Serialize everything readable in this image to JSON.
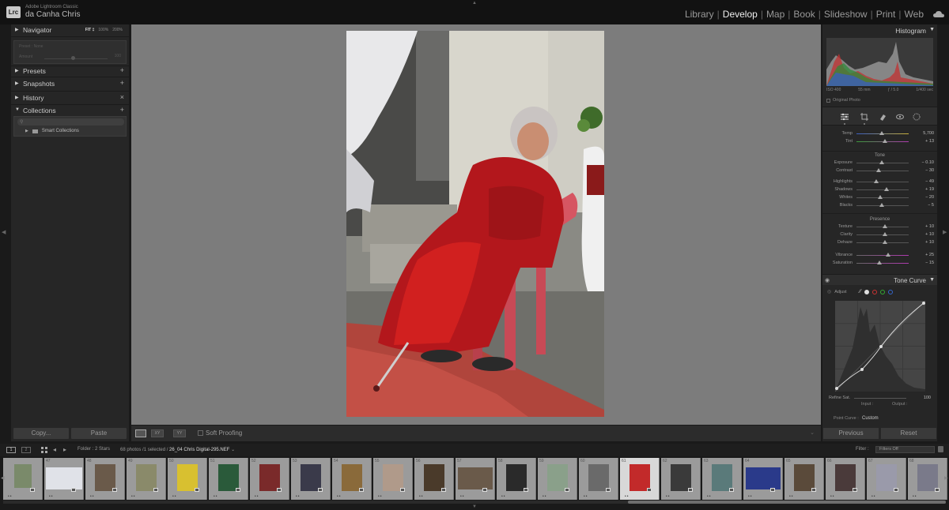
{
  "app": {
    "logo_text": "Lrc",
    "product_name": "Adobe Lightroom Classic",
    "user_name": "da Canha Chris"
  },
  "modules": [
    {
      "label": "Library",
      "active": false
    },
    {
      "label": "Develop",
      "active": true
    },
    {
      "label": "Map",
      "active": false
    },
    {
      "label": "Book",
      "active": false
    },
    {
      "label": "Slideshow",
      "active": false
    },
    {
      "label": "Print",
      "active": false
    },
    {
      "label": "Web",
      "active": false
    }
  ],
  "left_panel": {
    "navigator": {
      "label": "Navigator",
      "zoom_fit": "FIT ‡",
      "zoom_100": "100%",
      "zoom_200": "200%"
    },
    "navigator_preset": "Preset : None",
    "navigator_amount": "Amount",
    "navigator_amount_value": "100",
    "presets": {
      "label": "Presets"
    },
    "snapshots": {
      "label": "Snapshots"
    },
    "history": {
      "label": "History"
    },
    "collections": {
      "label": "Collections"
    },
    "smart_collections": "Smart Collections",
    "copy_label": "Copy...",
    "paste_label": "Paste"
  },
  "toolbar": {
    "soft_proofing_label": "Soft Proofing",
    "compare_label": "XY",
    "survey_label": "YY"
  },
  "right_panel": {
    "histogram_title": "Histogram",
    "iso": "ISO 400",
    "focal": "55 mm",
    "aperture": "ƒ / 5.0",
    "shutter": "1/400 sec",
    "original_photo": "Original Photo",
    "sections": {
      "tone": "Tone",
      "presence": "Presence"
    },
    "wb_sliders": [
      {
        "label": "Temp",
        "value": "5,700",
        "pos": 0.48
      },
      {
        "label": "Tint",
        "value": "+ 13",
        "pos": 0.55
      }
    ],
    "tone_sliders": [
      {
        "label": "Exposure",
        "value": "− 0.10",
        "pos": 0.48
      },
      {
        "label": "Contrast",
        "value": "− 30",
        "pos": 0.42
      },
      {
        "label": "Highlights",
        "value": "− 49",
        "pos": 0.38
      },
      {
        "label": "Shadows",
        "value": "+ 19",
        "pos": 0.58
      },
      {
        "label": "Whites",
        "value": "− 20",
        "pos": 0.45
      },
      {
        "label": "Blacks",
        "value": "− 5",
        "pos": 0.49
      }
    ],
    "presence_sliders": [
      {
        "label": "Texture",
        "value": "+ 10",
        "pos": 0.55
      },
      {
        "label": "Clarity",
        "value": "+ 10",
        "pos": 0.55
      },
      {
        "label": "Dehaze",
        "value": "+ 10",
        "pos": 0.55
      },
      {
        "label": "Vibrance",
        "value": "+ 25",
        "pos": 0.6
      },
      {
        "label": "Saturation",
        "value": "− 15",
        "pos": 0.44
      }
    ],
    "tone_curve_title": "Tone Curve",
    "adjust_label": "Adjust",
    "refine_sat_label": "Refine Sat.",
    "refine_sat_value": "100",
    "input_label": "Input :",
    "output_label": "Output :",
    "point_curve_label": "Point Curve :",
    "point_curve_value": "Custom",
    "previous_label": "Previous",
    "reset_label": "Reset"
  },
  "filmstrip_header": {
    "screen1": "1",
    "screen2": "2",
    "folder_text": "Folder : 2 Stars",
    "photos_count": "68 photos /1 selected /",
    "file_name": "26_04 Chris Digital-295.NEF",
    "filter_label": "Filter :",
    "filter_value": "Filters Off"
  },
  "filmstrip": [
    {
      "num": "",
      "dots": "••",
      "selected": false
    },
    {
      "num": "47",
      "dots": "••",
      "selected": false
    },
    {
      "num": "48",
      "dots": "••",
      "selected": false
    },
    {
      "num": "49",
      "dots": "••",
      "selected": false
    },
    {
      "num": "50",
      "dots": "••",
      "selected": false
    },
    {
      "num": "51",
      "dots": "••",
      "selected": false
    },
    {
      "num": "52",
      "dots": "••",
      "selected": false
    },
    {
      "num": "53",
      "dots": "••",
      "selected": false
    },
    {
      "num": "54",
      "dots": "••",
      "selected": false
    },
    {
      "num": "55",
      "dots": "••",
      "selected": false
    },
    {
      "num": "56",
      "dots": "••",
      "selected": false
    },
    {
      "num": "57",
      "dots": "••",
      "selected": false
    },
    {
      "num": "58",
      "dots": "••",
      "selected": false
    },
    {
      "num": "59",
      "dots": "••",
      "selected": false
    },
    {
      "num": "60",
      "dots": "••",
      "selected": false
    },
    {
      "num": "61",
      "dots": "••",
      "selected": true
    },
    {
      "num": "62",
      "dots": "••",
      "selected": false
    },
    {
      "num": "63",
      "dots": "••",
      "selected": false
    },
    {
      "num": "64",
      "dots": "••",
      "selected": false
    },
    {
      "num": "65",
      "dots": "••",
      "selected": false
    },
    {
      "num": "66",
      "dots": "••",
      "selected": false
    },
    {
      "num": "67",
      "dots": "••",
      "selected": false
    },
    {
      "num": "68",
      "dots": "••",
      "selected": false
    }
  ],
  "colors": {
    "accent": "#c21f1f",
    "panel": "#262626",
    "canvas": "#7c7c7c"
  }
}
